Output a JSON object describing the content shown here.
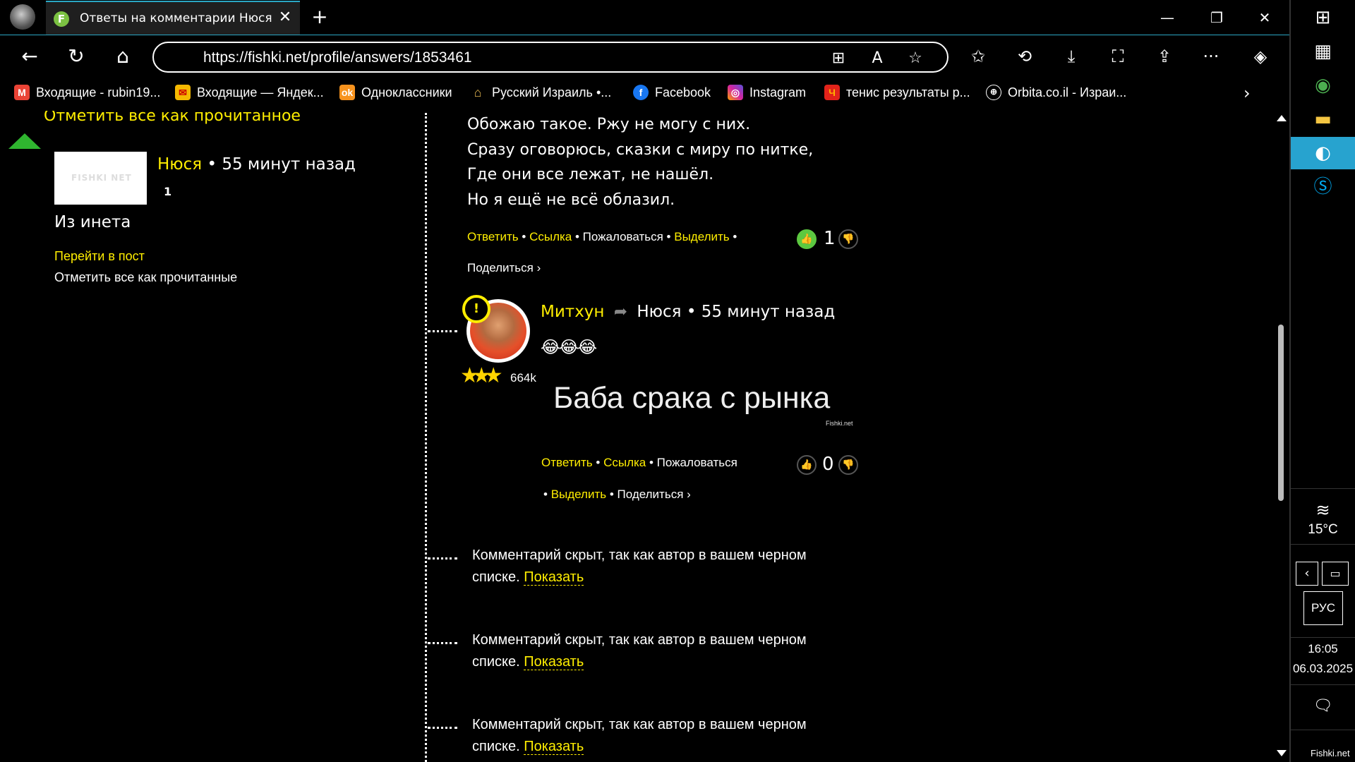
{
  "browser": {
    "tab_title": "Ответы на комментарии Нюся на",
    "tab_favicon_letter": "F",
    "url": "https://fishki.net/profile/answers/1853461",
    "bookmarks": [
      {
        "label": "Входящие - rubin19...",
        "icon": "gmail-icon",
        "color": "#ea4335"
      },
      {
        "label": "Входящие — Яндек...",
        "icon": "yandex-mail-icon",
        "color": "#f5b800"
      },
      {
        "label": "Одноклассники",
        "icon": "odnoklassniki-icon",
        "color": "#f7931e"
      },
      {
        "label": "Русский Израиль •...",
        "icon": "house-icon",
        "color": "#c8a040"
      },
      {
        "label": "Facebook",
        "icon": "facebook-icon",
        "color": "#1877f2"
      },
      {
        "label": "Instagram",
        "icon": "instagram-icon",
        "color": "#d6249f"
      },
      {
        "label": "тенис результаты р...",
        "icon": "tennis-site-icon",
        "color": "#e2231a"
      },
      {
        "label": "Orbita.co.il - Израи...",
        "icon": "globe-icon",
        "color": "#000000"
      }
    ]
  },
  "left_panel": {
    "mark_all_top": "Отметить всё как прочитанное",
    "post_author": "Нюся",
    "post_time": "• 55 минут назад",
    "post_count": "1",
    "thumb_logo": "FISHKI NET",
    "post_text": "Из инета",
    "goto_post": "Перейти в пост",
    "mark_all_read": "Отметить все как прочитанные"
  },
  "comment1": {
    "lines": [
      "Обожаю такое. Ржу не могу с них.",
      "Сразу оговорюсь, сказки с миру по нитке,",
      "Где они все лежат, не нашёл.",
      "Но я ещё не всё облазил."
    ],
    "reply": "Ответить",
    "link": "Ссылка",
    "report": "Пожаловаться",
    "highlight": "Выделить",
    "share": "Поделиться ›",
    "likes": "1"
  },
  "comment2": {
    "author": "Митхун",
    "reply_to": "Нюся",
    "time": "• 55 минут назад",
    "emojis": "😂😂😂",
    "rating": "664k",
    "image_text": "Баба срака с рынка",
    "watermark": "Fishki.net",
    "reply": "Ответить",
    "link": "Ссылка",
    "report": "Пожаловаться",
    "highlight": "Выделить",
    "share": "Поделиться ›",
    "likes": "0"
  },
  "hidden_comments": [
    {
      "text": "Комментарий скрыт, так как автор в вашем черном",
      "text2": "списке.",
      "show": "Показать"
    },
    {
      "text": "Комментарий скрыт, так как автор в вашем черном",
      "text2": "списке.",
      "show": "Показать"
    },
    {
      "text": "Комментарий скрыт, так как автор в вашем черном",
      "text2": "списке.",
      "show": "Показать"
    }
  ],
  "taskbar": {
    "temperature": "15°C",
    "language": "РУС",
    "time": "16:05",
    "date": "06.03.2025",
    "corner_label": "Fishki.net"
  },
  "colors": {
    "accent_yellow": "#ffee00",
    "edge_blue": "#2aa7c4",
    "like_green": "#5cc840"
  }
}
